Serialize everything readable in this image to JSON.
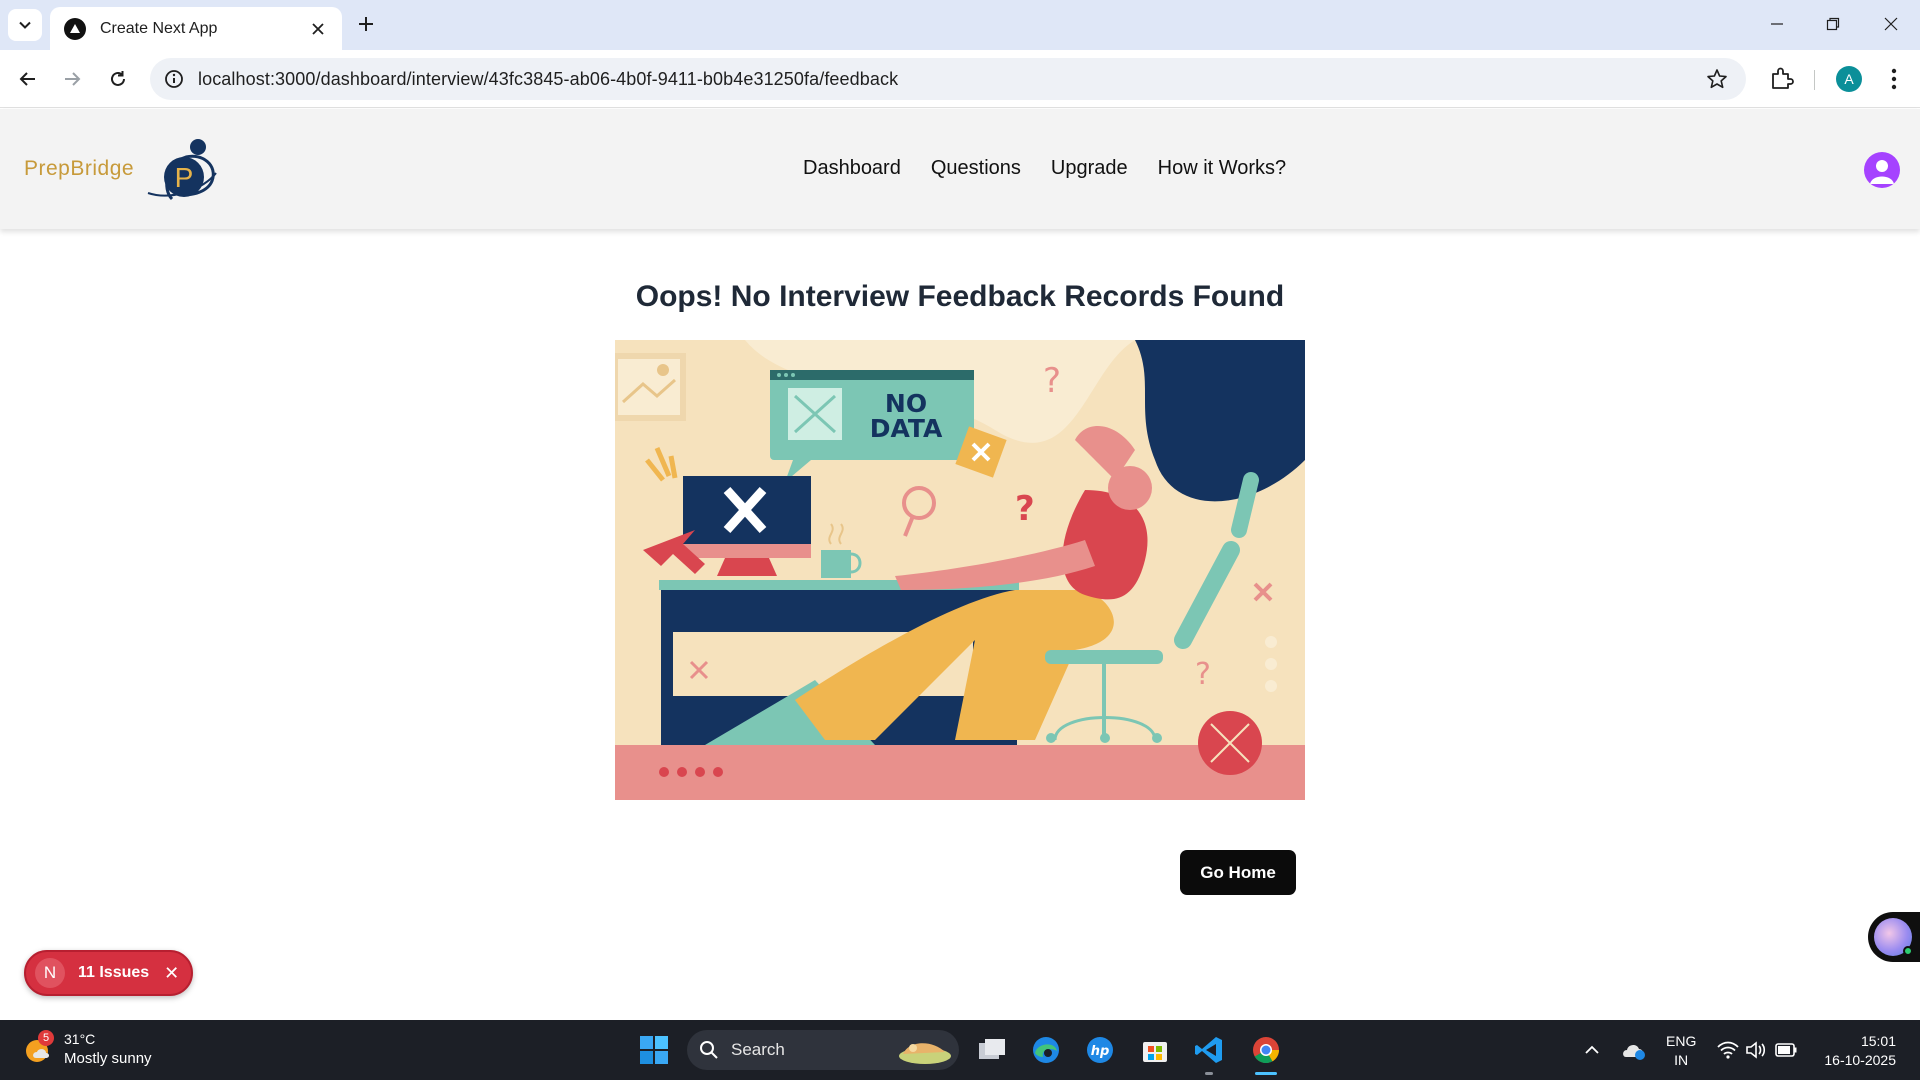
{
  "browser": {
    "tab_title": "Create Next App",
    "url": "localhost:3000/dashboard/interview/43fc3845-ab06-4b0f-9411-b0b4e31250fa/feedback",
    "profile_initial": "A"
  },
  "header": {
    "brand": "PrepBridge",
    "logo_letter": "P",
    "nav": [
      "Dashboard",
      "Questions",
      "Upgrade",
      "How it Works?"
    ]
  },
  "main": {
    "title": "Oops! No Interview Feedback Records Found",
    "illustration_text_line1": "NO",
    "illustration_text_line2": "DATA",
    "go_home_label": "Go Home"
  },
  "issues_toast": {
    "badge": "N",
    "label": "11 Issues"
  },
  "taskbar": {
    "weather_badge": "5",
    "temperature": "31°C",
    "condition": "Mostly sunny",
    "search_label": "Search",
    "lang_line1": "ENG",
    "lang_line2": "IN",
    "time": "15:01",
    "date": "16-10-2025"
  },
  "colors": {
    "brand_gold": "#c79a3a",
    "navy": "#14335f",
    "coral": "#e8908c",
    "teal": "#7cc6b4",
    "issues_red": "#d53040",
    "button_black": "#0b0b0b"
  }
}
